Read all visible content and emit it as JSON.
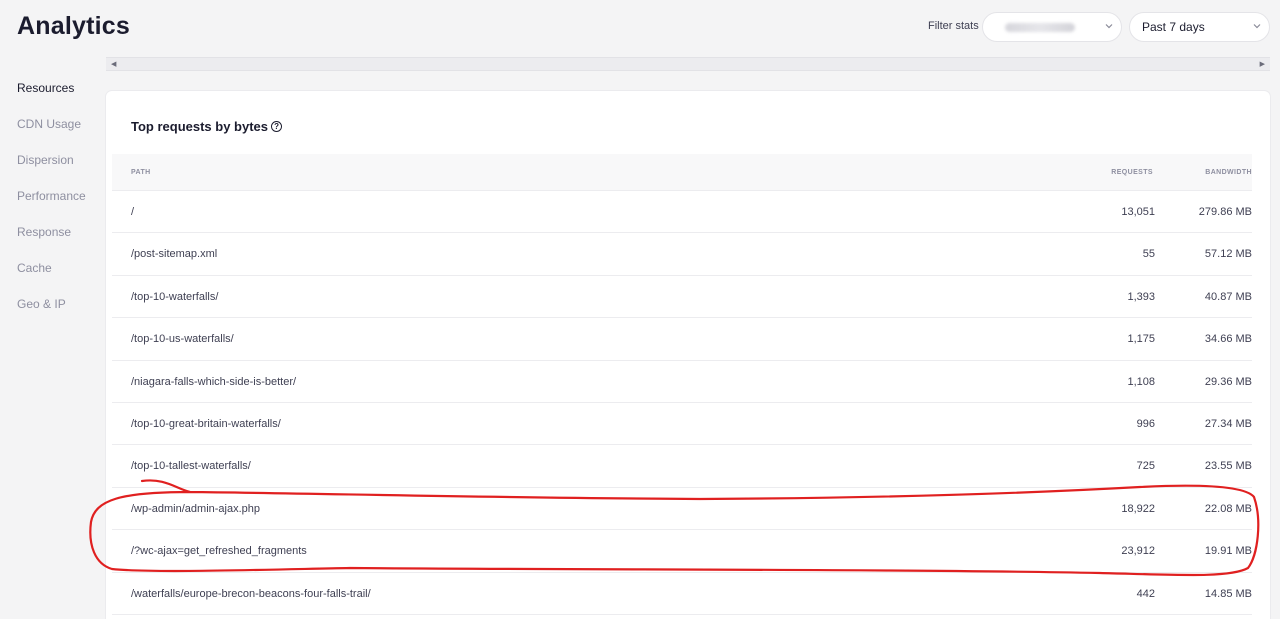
{
  "header": {
    "title": "Analytics",
    "filter_label": "Filter stats",
    "site_select_value": "",
    "range_select_value": "Past 7 days"
  },
  "sidebar": {
    "items": [
      {
        "label": "Resources",
        "active": true
      },
      {
        "label": "CDN Usage",
        "active": false
      },
      {
        "label": "Dispersion",
        "active": false
      },
      {
        "label": "Performance",
        "active": false
      },
      {
        "label": "Response",
        "active": false
      },
      {
        "label": "Cache",
        "active": false
      },
      {
        "label": "Geo & IP",
        "active": false
      }
    ]
  },
  "card": {
    "title": "Top requests by bytes",
    "help_icon": "?",
    "columns": {
      "path": "PATH",
      "requests": "REQUESTS",
      "bandwidth": "BANDWIDTH"
    },
    "rows": [
      {
        "path": "/",
        "requests": "13,051",
        "bandwidth": "279.86 MB"
      },
      {
        "path": "/post-sitemap.xml",
        "requests": "55",
        "bandwidth": "57.12 MB"
      },
      {
        "path": "/top-10-waterfalls/",
        "requests": "1,393",
        "bandwidth": "40.87 MB"
      },
      {
        "path": "/top-10-us-waterfalls/",
        "requests": "1,175",
        "bandwidth": "34.66 MB"
      },
      {
        "path": "/niagara-falls-which-side-is-better/",
        "requests": "1,108",
        "bandwidth": "29.36 MB"
      },
      {
        "path": "/top-10-great-britain-waterfalls/",
        "requests": "996",
        "bandwidth": "27.34 MB"
      },
      {
        "path": "/top-10-tallest-waterfalls/",
        "requests": "725",
        "bandwidth": "23.55 MB"
      },
      {
        "path": "/wp-admin/admin-ajax.php",
        "requests": "18,922",
        "bandwidth": "22.08 MB"
      },
      {
        "path": "/?wc-ajax=get_refreshed_fragments",
        "requests": "23,912",
        "bandwidth": "19.91 MB"
      },
      {
        "path": "/waterfalls/europe-brecon-beacons-four-falls-trail/",
        "requests": "442",
        "bandwidth": "14.85 MB"
      }
    ]
  },
  "annotation": {
    "color": "#e02020",
    "highlighted_rows": [
      7,
      8
    ]
  }
}
